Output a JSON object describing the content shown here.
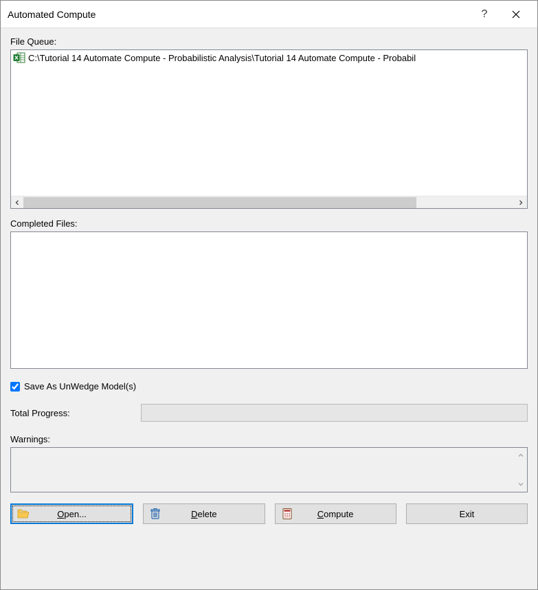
{
  "window": {
    "title": "Automated Compute",
    "help": "?",
    "close": "×"
  },
  "labels": {
    "file_queue": "File Queue:",
    "completed": "Completed Files:",
    "save_as": "Save As UnWedge Model(s)",
    "total_progress": "Total Progress:",
    "warnings": "Warnings:"
  },
  "file_queue": {
    "items": [
      {
        "icon": "excel-file-icon",
        "text": "C:\\Tutorial 14 Automate Compute - Probabilistic Analysis\\Tutorial 14 Automate Compute - Probabil"
      }
    ]
  },
  "completed_files": {
    "items": []
  },
  "checkbox": {
    "save_as_checked": true
  },
  "buttons": {
    "open": {
      "label_pre": "",
      "label_u": "O",
      "label_post": "pen..."
    },
    "delete": {
      "label_pre": "",
      "label_u": "D",
      "label_post": "elete"
    },
    "compute": {
      "label_pre": "",
      "label_u": "C",
      "label_post": "ompute"
    },
    "exit": {
      "label_pre": "Exit",
      "label_u": "",
      "label_post": ""
    }
  }
}
